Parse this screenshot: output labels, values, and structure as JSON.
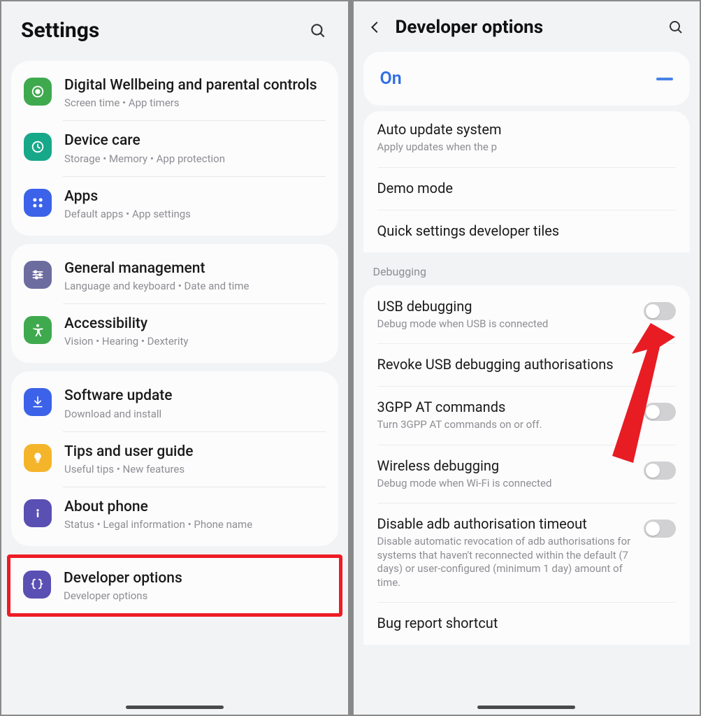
{
  "left": {
    "title": "Settings",
    "groups": [
      [
        {
          "title": "Digital Wellbeing and parental controls",
          "sub": "Screen time  •  App timers",
          "color": "#3fa94e",
          "icon": "wellbeing"
        },
        {
          "title": "Device care",
          "sub": "Storage  •  Memory  •  App protection",
          "color": "#17a889",
          "icon": "devicecare"
        },
        {
          "title": "Apps",
          "sub": "Default apps  •  App settings",
          "color": "#3b62e8",
          "icon": "apps"
        }
      ],
      [
        {
          "title": "General management",
          "sub": "Language and keyboard  •  Date and time",
          "color": "#6d6c9f",
          "icon": "sliders"
        },
        {
          "title": "Accessibility",
          "sub": "Vision  •  Hearing  •  Dexterity",
          "color": "#3fa94e",
          "icon": "accessibility"
        }
      ],
      [
        {
          "title": "Software update",
          "sub": "Download and install",
          "color": "#3b62e8",
          "icon": "update"
        },
        {
          "title": "Tips and user guide",
          "sub": "Useful tips  •  New features",
          "color": "#f5b52b",
          "icon": "tips"
        },
        {
          "title": "About phone",
          "sub": "Status  •  Legal information  •  Phone name",
          "color": "#5a4fb2",
          "icon": "about"
        }
      ]
    ],
    "highlight": {
      "title": "Developer options",
      "sub": "Developer options",
      "color": "#5a4fb2",
      "icon": "braces"
    }
  },
  "right": {
    "title": "Developer options",
    "master": {
      "label": "On"
    },
    "pre_items": [
      {
        "title": "Auto update system",
        "sub": "Apply updates when the p"
      },
      {
        "title": "Demo mode",
        "sub": ""
      },
      {
        "title": "Quick settings developer tiles",
        "sub": ""
      }
    ],
    "section": "Debugging",
    "debug_items": [
      {
        "title": "USB debugging",
        "sub": "Debug mode when USB is connected",
        "toggle": true
      },
      {
        "title": "Revoke USB debugging authorisations",
        "sub": "",
        "toggle": false
      },
      {
        "title": "3GPP AT commands",
        "sub": "Turn 3GPP AT commands on or off.",
        "toggle": true
      },
      {
        "title": "Wireless debugging",
        "sub": "Debug mode when Wi-Fi is connected",
        "toggle": true
      },
      {
        "title": "Disable adb authorisation timeout",
        "sub": "Disable automatic revocation of adb authorisations for systems that haven't reconnected within the default (7 days) or user-configured (minimum 1 day) amount of time.",
        "toggle": true
      },
      {
        "title": "Bug report shortcut",
        "sub": "",
        "toggle": false
      }
    ]
  }
}
